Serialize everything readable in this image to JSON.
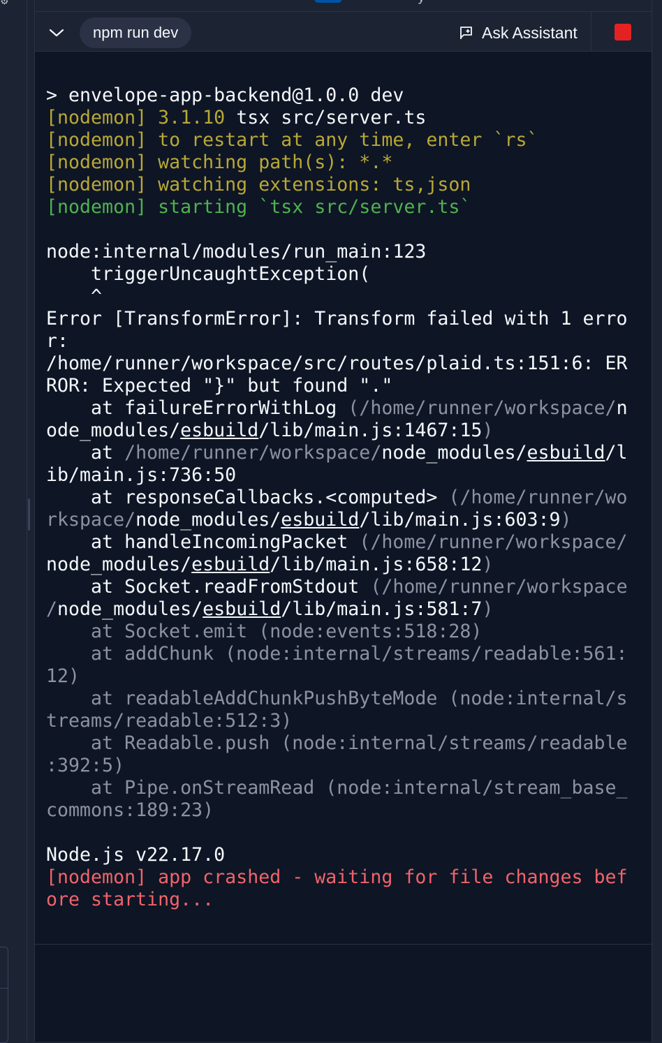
{
  "toolbar": {
    "run_command": "npm run dev",
    "ask_assistant_label": "Ask Assistant"
  },
  "colors": {
    "accent": "#0053a6",
    "stop": "#e52222",
    "nodemon_yellow": "#b8a835",
    "nodemon_green": "#4fb24f",
    "error_red": "#f0646a",
    "dim_gray": "#8c92a3"
  },
  "icons": {
    "collapse": "chevron-down-icon",
    "assistant": "chat-flag-icon",
    "stop": "stop-square-icon"
  },
  "terminal": {
    "lines": [
      {
        "segments": [
          {
            "text": "> envelope-app-backend@1.0.0 dev",
            "color": "white"
          }
        ]
      },
      {
        "segments": [
          {
            "text": "[nodemon] 3.1.10 ",
            "color": "yellow"
          },
          {
            "text": "tsx src/server.ts",
            "color": "white"
          }
        ]
      },
      {
        "segments": [
          {
            "text": "[nodemon] to restart at any time, enter `rs`",
            "color": "yellow"
          }
        ]
      },
      {
        "segments": [
          {
            "text": "[nodemon] watching path(s): *.*",
            "color": "yellow"
          }
        ]
      },
      {
        "segments": [
          {
            "text": "[nodemon] watching extensions: ts,json",
            "color": "yellow"
          }
        ]
      },
      {
        "segments": [
          {
            "text": "[nodemon] starting `tsx src/server.ts`",
            "color": "green"
          }
        ]
      },
      {
        "segments": [
          {
            "text": "",
            "color": "white"
          }
        ]
      },
      {
        "segments": [
          {
            "text": "node:internal/modules/run_main:123",
            "color": "white"
          }
        ]
      },
      {
        "segments": [
          {
            "text": "    triggerUncaughtException(",
            "color": "white"
          }
        ]
      },
      {
        "segments": [
          {
            "text": "    ^",
            "color": "white"
          }
        ]
      },
      {
        "segments": [
          {
            "text": "Error [TransformError]: Transform failed with 1 erro",
            "color": "white"
          }
        ]
      },
      {
        "segments": [
          {
            "text": "r:",
            "color": "white"
          }
        ]
      },
      {
        "segments": [
          {
            "text": "/home/runner/workspace/src/routes/plaid.ts:151:6: ER",
            "color": "white"
          }
        ]
      },
      {
        "segments": [
          {
            "text": "ROR: Expected \"}\" but found \".\"",
            "color": "white"
          }
        ]
      },
      {
        "segments": [
          {
            "text": "    at failureErrorWithLog ",
            "color": "white"
          },
          {
            "text": "(/home/runner/workspace/",
            "color": "gray"
          },
          {
            "text": "n",
            "color": "white"
          }
        ]
      },
      {
        "segments": [
          {
            "text": "ode_modules/",
            "color": "white"
          },
          {
            "text": "esbuild",
            "color": "white",
            "underline": true
          },
          {
            "text": "/lib/main.js:1467:15",
            "color": "white"
          },
          {
            "text": ")",
            "color": "gray"
          }
        ]
      },
      {
        "segments": [
          {
            "text": "    at ",
            "color": "white"
          },
          {
            "text": "/home/runner/workspace/",
            "color": "gray"
          },
          {
            "text": "node_modules/",
            "color": "white"
          },
          {
            "text": "esbuild",
            "color": "white",
            "underline": true
          },
          {
            "text": "/l",
            "color": "white"
          }
        ]
      },
      {
        "segments": [
          {
            "text": "ib/main.js:736:50",
            "color": "white"
          }
        ]
      },
      {
        "segments": [
          {
            "text": "    at responseCallbacks.<computed> ",
            "color": "white"
          },
          {
            "text": "(/home/runner/wo",
            "color": "gray"
          }
        ]
      },
      {
        "segments": [
          {
            "text": "rkspace/",
            "color": "gray"
          },
          {
            "text": "node_modules/",
            "color": "white"
          },
          {
            "text": "esbuild",
            "color": "white",
            "underline": true
          },
          {
            "text": "/lib/main.js:603:9",
            "color": "white"
          },
          {
            "text": ")",
            "color": "gray"
          }
        ]
      },
      {
        "segments": [
          {
            "text": "    at handleIncomingPacket ",
            "color": "white"
          },
          {
            "text": "(/home/runner/workspace/",
            "color": "gray"
          }
        ]
      },
      {
        "segments": [
          {
            "text": "node_modules/",
            "color": "white"
          },
          {
            "text": "esbuild",
            "color": "white",
            "underline": true
          },
          {
            "text": "/lib/main.js:658:12",
            "color": "white"
          },
          {
            "text": ")",
            "color": "gray"
          }
        ]
      },
      {
        "segments": [
          {
            "text": "    at Socket.readFromStdout ",
            "color": "white"
          },
          {
            "text": "(/home/runner/workspace",
            "color": "gray"
          }
        ]
      },
      {
        "segments": [
          {
            "text": "/",
            "color": "gray"
          },
          {
            "text": "node_modules/",
            "color": "white"
          },
          {
            "text": "esbuild",
            "color": "white",
            "underline": true
          },
          {
            "text": "/lib/main.js:581:7",
            "color": "white"
          },
          {
            "text": ")",
            "color": "gray"
          }
        ]
      },
      {
        "segments": [
          {
            "text": "    at Socket.emit (node:events:518:28)",
            "color": "gray"
          }
        ]
      },
      {
        "segments": [
          {
            "text": "    at addChunk (node:internal/streams/readable:561:",
            "color": "gray"
          }
        ]
      },
      {
        "segments": [
          {
            "text": "12)",
            "color": "gray"
          }
        ]
      },
      {
        "segments": [
          {
            "text": "    at readableAddChunkPushByteMode (node:internal/s",
            "color": "gray"
          }
        ]
      },
      {
        "segments": [
          {
            "text": "treams/readable:512:3)",
            "color": "gray"
          }
        ]
      },
      {
        "segments": [
          {
            "text": "    at Readable.push (node:internal/streams/readable",
            "color": "gray"
          }
        ]
      },
      {
        "segments": [
          {
            "text": ":392:5)",
            "color": "gray"
          }
        ]
      },
      {
        "segments": [
          {
            "text": "    at Pipe.onStreamRead (node:internal/stream_base_",
            "color": "gray"
          }
        ]
      },
      {
        "segments": [
          {
            "text": "commons:189:23)",
            "color": "gray"
          }
        ]
      },
      {
        "segments": [
          {
            "text": "",
            "color": "white"
          }
        ]
      },
      {
        "segments": [
          {
            "text": "Node.js v22.17.0",
            "color": "white"
          }
        ]
      },
      {
        "segments": [
          {
            "text": "[nodemon] app crashed - waiting for file changes bef",
            "color": "red"
          }
        ]
      },
      {
        "segments": [
          {
            "text": "ore starting...",
            "color": "red"
          }
        ]
      }
    ]
  }
}
